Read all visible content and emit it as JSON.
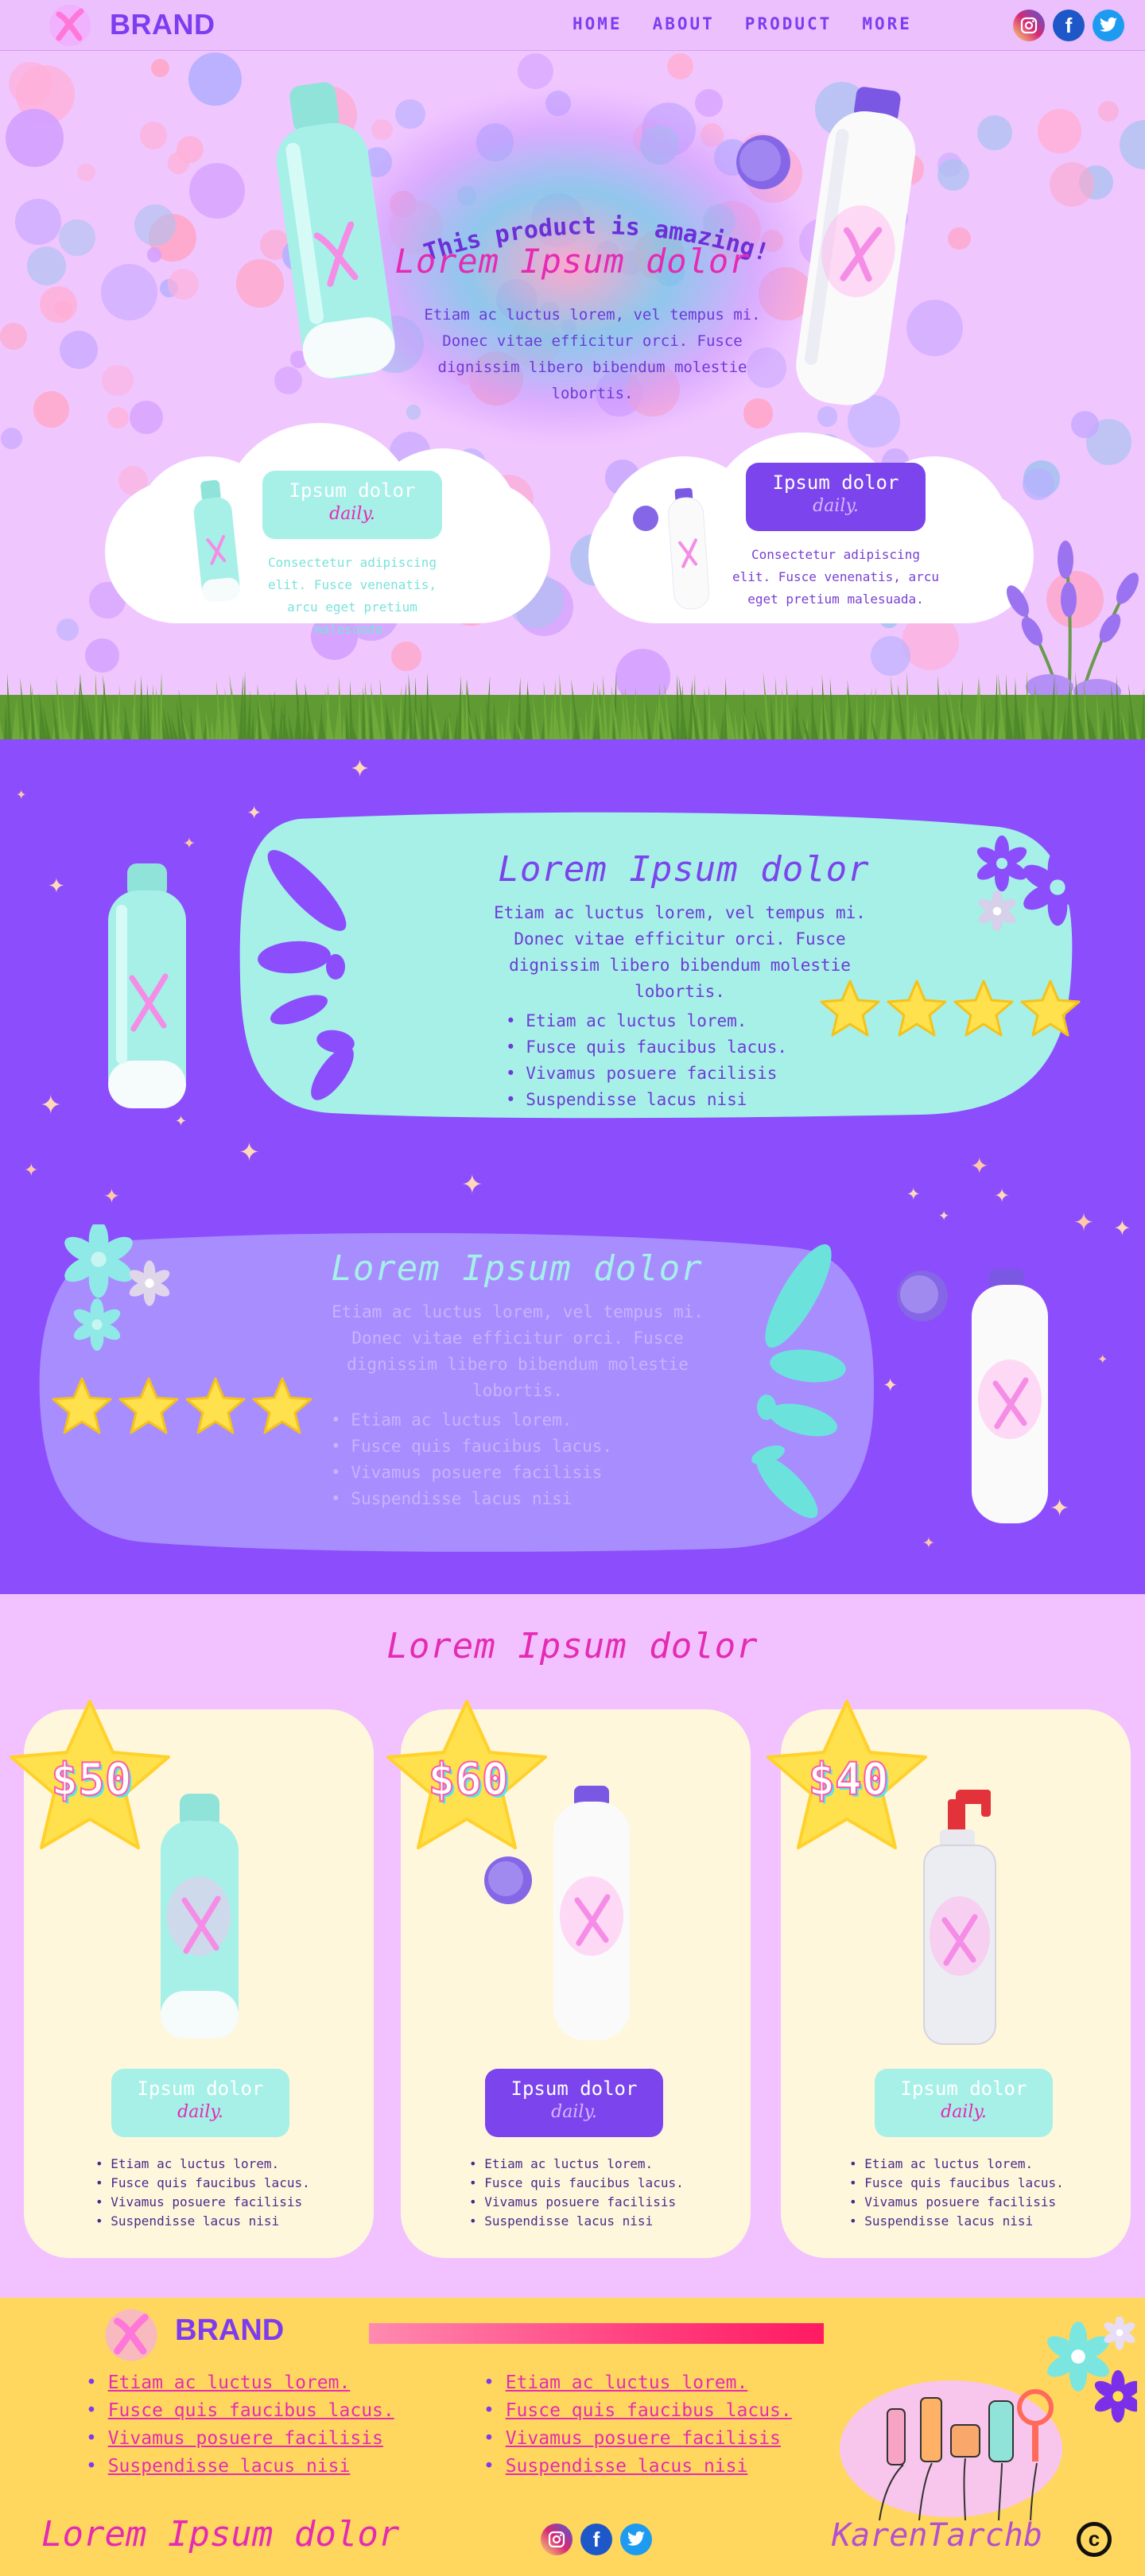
{
  "header": {
    "brand": "BRAND",
    "nav": [
      "HOME",
      "ABOUT",
      "PRODUCT",
      "MORE"
    ],
    "social": [
      "instagram-icon",
      "facebook-icon",
      "twitter-icon"
    ]
  },
  "hero": {
    "arc_title": "This product is amazing!",
    "title": "Lorem Ipsum dolor",
    "text": "Etiam ac luctus lorem, vel tempus mi. Donec vitae efficitur orci. Fusce dignissim libero bibendum molestie lobortis.",
    "clouds": [
      {
        "pill": "Ipsum dolor",
        "daily": "daily.",
        "text": "Consectetur adipiscing elit. Fusce venenatis, arcu eget pretium malesuada."
      },
      {
        "pill": "Ipsum dolor",
        "daily": "daily.",
        "text": "Consectetur adipiscing elit. Fusce venenatis, arcu eget pretium malesuada."
      }
    ]
  },
  "features": [
    {
      "title": "Lorem Ipsum dolor",
      "text": "Etiam ac luctus lorem, vel tempus mi. Donec vitae efficitur orci. Fusce dignissim libero bibendum molestie lobortis.",
      "items": [
        "Etiam ac luctus lorem.",
        "Fusce quis faucibus lacus.",
        "Vivamus posuere facilisis",
        "Suspendisse lacus nisi"
      ],
      "stars": 4
    },
    {
      "title": "Lorem Ipsum dolor",
      "text": "Etiam ac luctus lorem, vel tempus mi. Donec vitae efficitur orci. Fusce dignissim libero bibendum molestie lobortis.",
      "items": [
        "Etiam ac luctus lorem.",
        "Fusce quis faucibus lacus.",
        "Vivamus posuere facilisis",
        "Suspendisse lacus nisi"
      ],
      "stars": 4
    }
  ],
  "pricing": {
    "title": "Lorem Ipsum dolor",
    "cards": [
      {
        "price": "$50",
        "pill": "Ipsum dolor",
        "daily": "daily.",
        "items": [
          "Etiam ac luctus lorem.",
          "Fusce quis faucibus lacus.",
          "Vivamus posuere facilisis",
          "Suspendisse lacus nisi"
        ]
      },
      {
        "price": "$60",
        "pill": "Ipsum dolor",
        "daily": "daily.",
        "items": [
          "Etiam ac luctus lorem.",
          "Fusce quis faucibus lacus.",
          "Vivamus posuere facilisis",
          "Suspendisse lacus nisi"
        ]
      },
      {
        "price": "$40",
        "pill": "Ipsum dolor",
        "daily": "daily.",
        "items": [
          "Etiam ac luctus lorem.",
          "Fusce quis faucibus lacus.",
          "Vivamus posuere facilisis",
          "Suspendisse lacus nisi"
        ]
      }
    ]
  },
  "footer": {
    "brand": "BRAND",
    "links_left": [
      "Etiam ac luctus lorem.",
      "Fusce quis faucibus lacus.",
      "Vivamus posuere facilisis",
      "Suspendisse lacus nisi"
    ],
    "links_right": [
      "Etiam ac luctus lorem.",
      "Fusce quis faucibus lacus.",
      "Vivamus posuere facilisis",
      "Suspendisse lacus nisi"
    ],
    "tagline": "Lorem Ipsum dolor",
    "author": "KarenTarchb",
    "copyright_symbol": "c"
  },
  "colors": {
    "purple": "#8c4dfc",
    "mint": "#a6f0e8",
    "pink": "#e52bb3",
    "lavender": "#f1c2ff",
    "yellow": "#ffd75e",
    "cream": "#fff7dc"
  }
}
